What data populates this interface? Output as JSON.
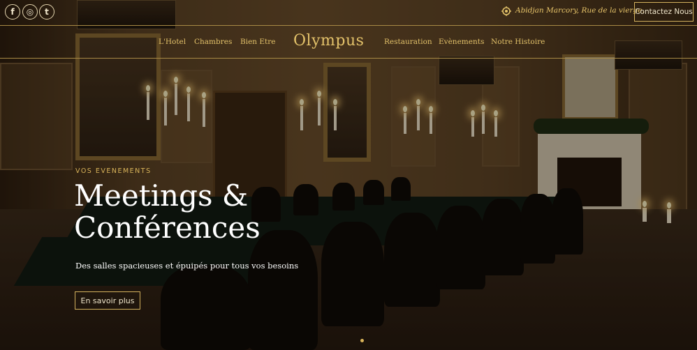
{
  "social": [
    {
      "icon": "facebook-icon",
      "glyph": "f"
    },
    {
      "icon": "instagram-icon",
      "glyph": "◎"
    },
    {
      "icon": "twitter-icon",
      "glyph": "t"
    }
  ],
  "topbar": {
    "address": "Abidjan Marcory, Rue de la vierge.",
    "address_icon": "location-icon",
    "contact_label": "Contactez Nous"
  },
  "nav": {
    "left": [
      "L'Hotel",
      "Chambres",
      "Bien Etre"
    ],
    "logo": "Olympus",
    "right": [
      "Restauration",
      "Evènements",
      "Notre Histoire"
    ]
  },
  "hero": {
    "eyebrow": "VOS EVENEMENTS",
    "title_line1": "Meetings &",
    "title_line2": "Conférences",
    "subtitle": "Des salles spacieuses et épuipés pour tous vos besoins",
    "cta_label": "En savoir plus",
    "slide_count": 1,
    "active_slide": 1
  },
  "colors": {
    "accent": "#e3c26a",
    "text": "#ffffff"
  }
}
